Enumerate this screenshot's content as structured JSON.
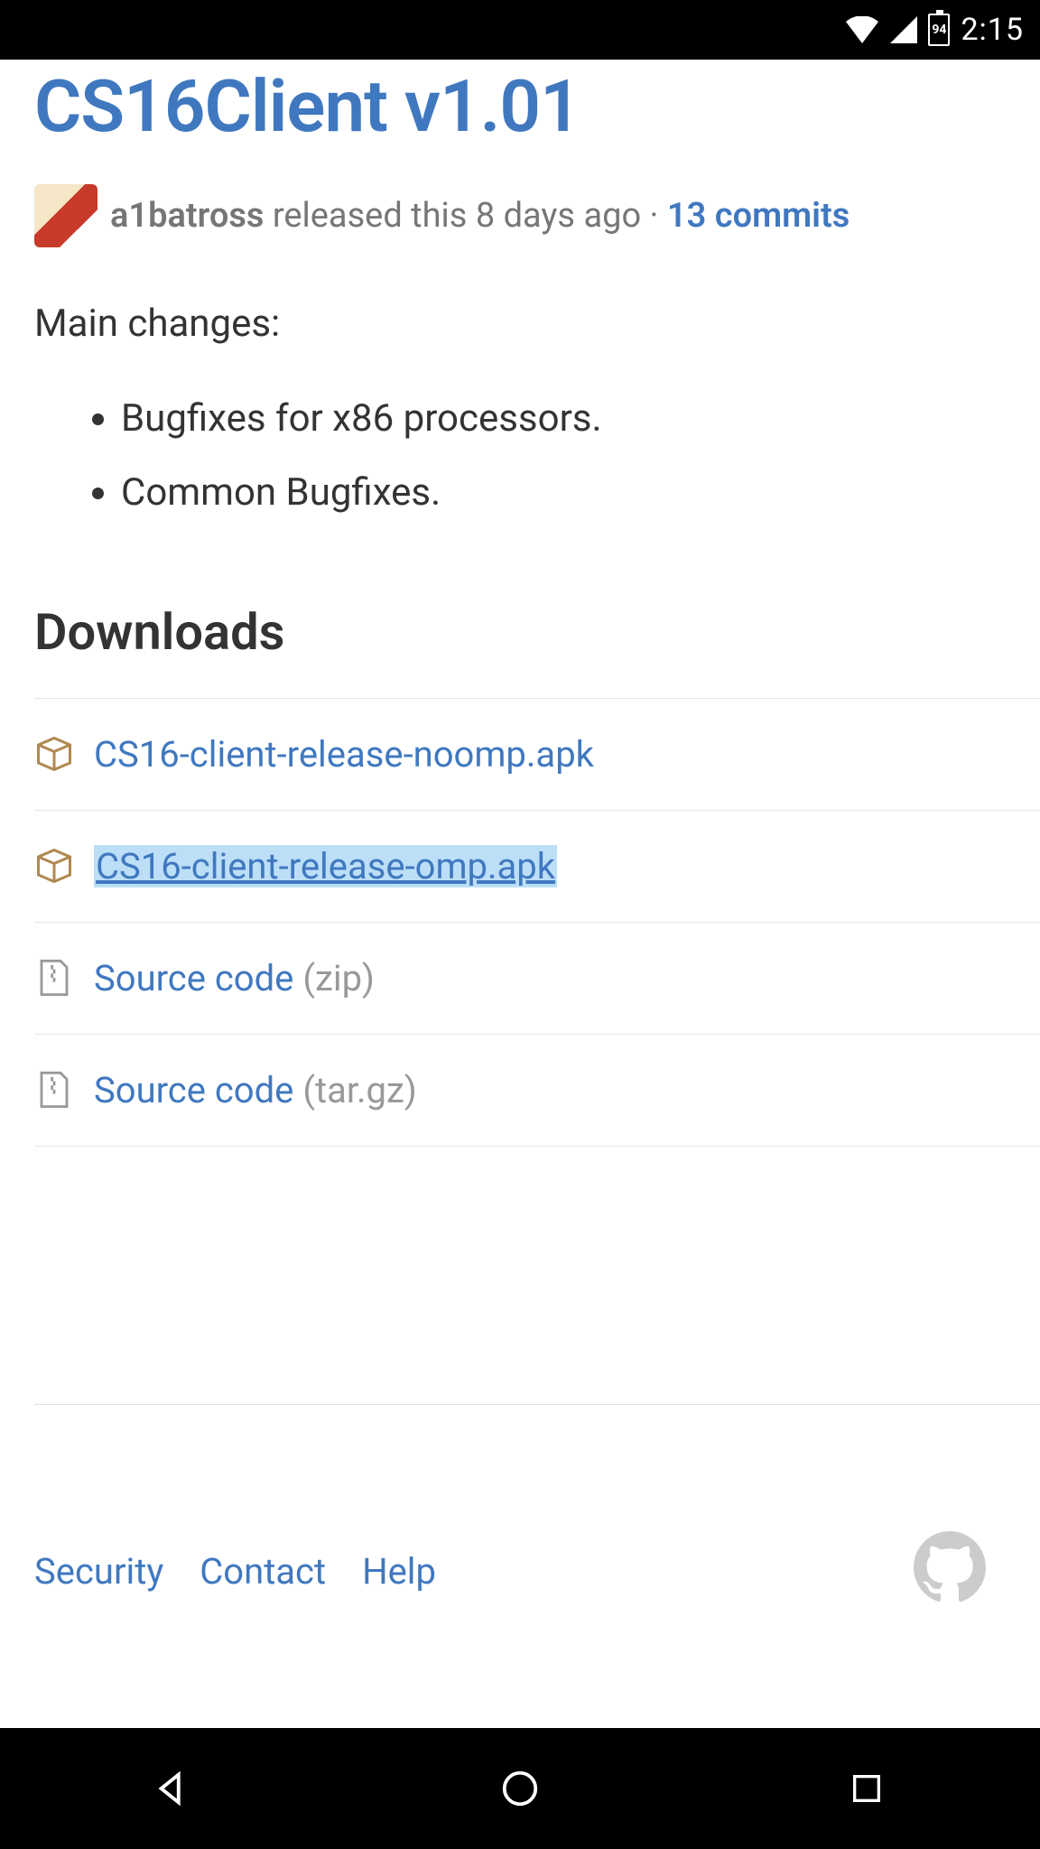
{
  "status_bar": {
    "battery_pct": "94",
    "time": "2:15"
  },
  "release": {
    "title": "CS16Client v1.01",
    "author": "a1batross",
    "released_text": " released this 8 days ago · ",
    "commits": "13 commits",
    "main_changes_label": "Main changes:",
    "changes": [
      "Bugfixes for x86 processors.",
      "Common Bugfixes."
    ],
    "downloads_heading": "Downloads",
    "downloads": [
      {
        "name": "CS16-client-release-noomp.apk",
        "kind": "package",
        "highlight": false,
        "suffix": ""
      },
      {
        "name": "CS16-client-release-omp.apk",
        "kind": "package",
        "highlight": true,
        "suffix": ""
      },
      {
        "name": "Source code",
        "kind": "zip",
        "highlight": false,
        "suffix": " (zip)"
      },
      {
        "name": "Source code",
        "kind": "zip",
        "highlight": false,
        "suffix": " (tar.gz)"
      }
    ]
  },
  "footer": {
    "links": [
      "Security",
      "Contact",
      "Help"
    ]
  }
}
